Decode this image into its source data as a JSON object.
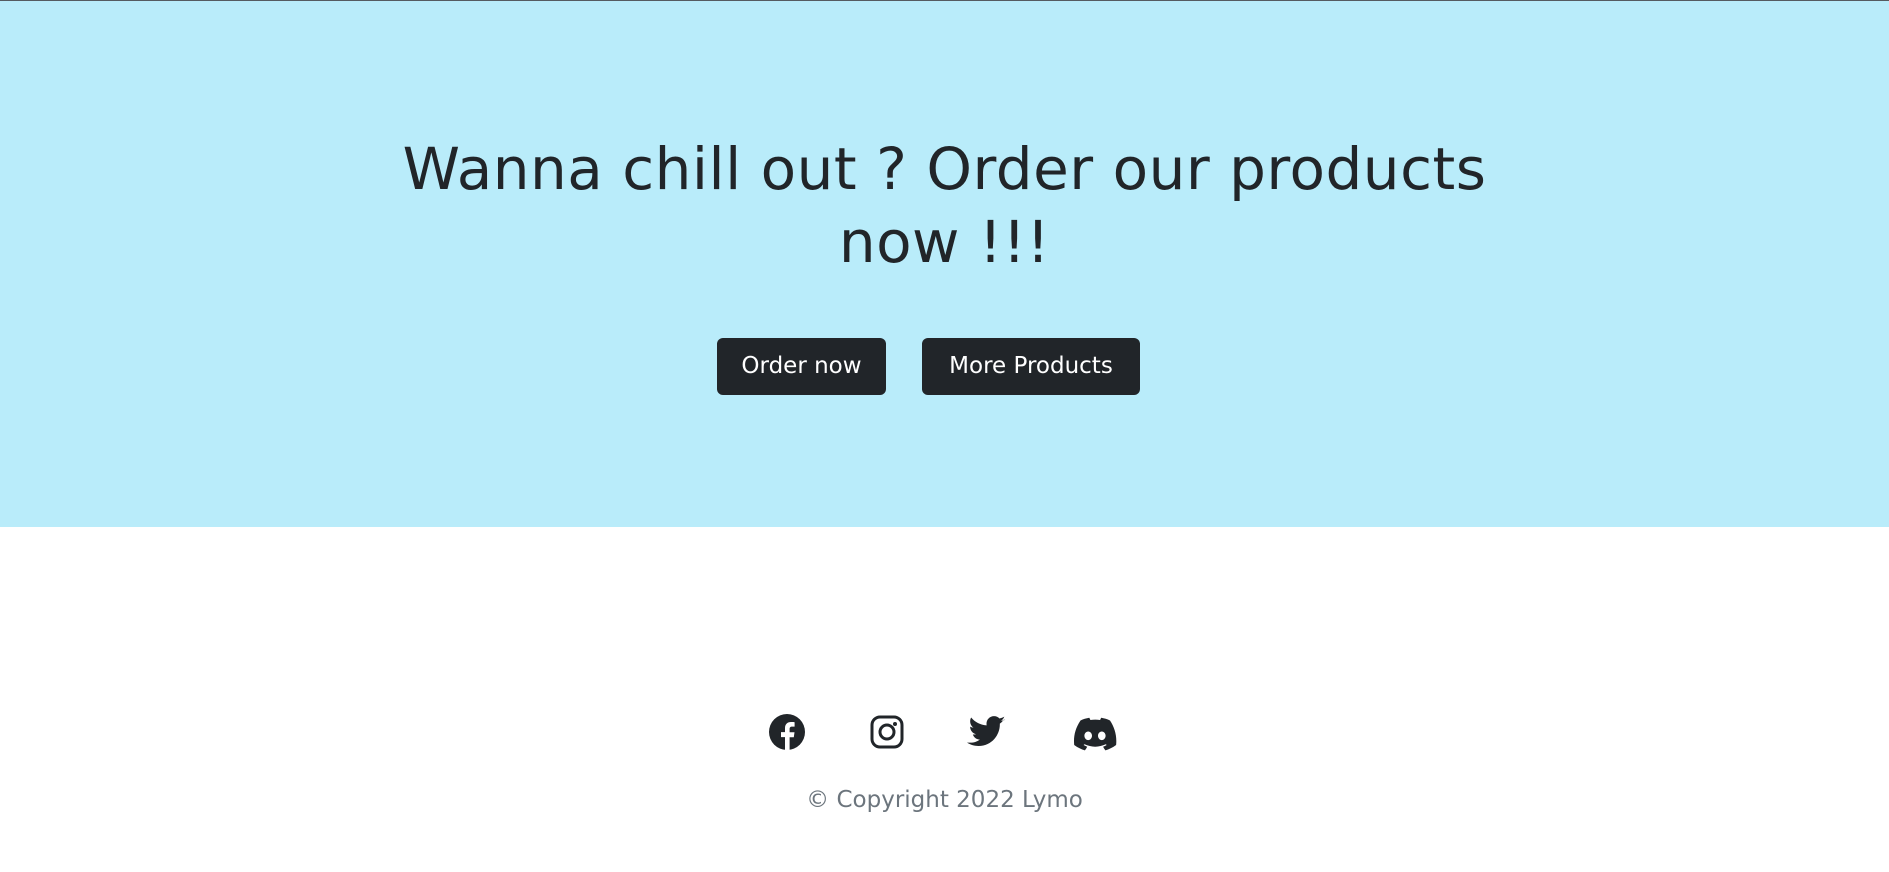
{
  "hero": {
    "title_line1": "Wanna chill out ? Order our products",
    "title_line2": "now !!!",
    "background": "#b9ecfa",
    "buttons": {
      "order_label": "Order now",
      "more_label": "More Products",
      "color": "#212529"
    }
  },
  "footer": {
    "social": [
      {
        "name": "facebook-icon"
      },
      {
        "name": "instagram-icon"
      },
      {
        "name": "twitter-icon"
      },
      {
        "name": "discord-icon"
      }
    ],
    "copyright": "© Copyright 2022 Lymo"
  }
}
